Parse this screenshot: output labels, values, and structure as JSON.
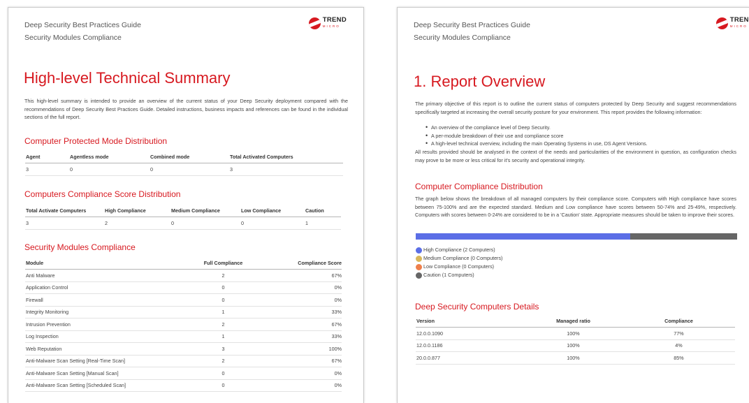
{
  "page1": {
    "header_line1": "Deep Security Best Practices Guide",
    "header_line2": "Security Modules Compliance",
    "logo_text": "TREND",
    "logo_sub": "MICRO",
    "title": "High-level Technical Summary",
    "intro": "This high-level summary is intended to provide an overview of the current status of your Deep Security deployment compared with the recommendations of Deep Security Best Practices Guide. Detailed instructions, business impacts and references can be found in the individual sections of the full report.",
    "section1": {
      "title": "Computer Protected Mode Distribution",
      "headers": [
        "Agent",
        "Agentless mode",
        "Combined mode",
        "Total Activated Computers"
      ],
      "row": [
        "3",
        "0",
        "0",
        "3"
      ]
    },
    "section2": {
      "title": "Computers Compliance Score Distribution",
      "headers": [
        "Total Activate Computers",
        "High Compliance",
        "Medium Compliance",
        "Low Compliance",
        "Caution"
      ],
      "row": [
        "3",
        "2",
        "0",
        "0",
        "1"
      ]
    },
    "section3": {
      "title": "Security Modules Compliance",
      "headers": [
        "Module",
        "Full Compliance",
        "Compliance Score"
      ],
      "rows": [
        [
          "Anti Malware",
          "2",
          "67%"
        ],
        [
          "Application Control",
          "0",
          "0%"
        ],
        [
          "Firewall",
          "0",
          "0%"
        ],
        [
          "Integrity Monitoring",
          "1",
          "33%"
        ],
        [
          "Intrusion Prevention",
          "2",
          "67%"
        ],
        [
          "Log Inspection",
          "1",
          "33%"
        ],
        [
          "Web Reputation",
          "3",
          "100%"
        ],
        [
          "Anti-Malware Scan Setting [Real-Time Scan]",
          "2",
          "67%"
        ],
        [
          "Anti-Malware Scan Setting [Manual Scan]",
          "0",
          "0%"
        ],
        [
          "Anti-Malware Scan Setting [Scheduled Scan]",
          "0",
          "0%"
        ]
      ]
    }
  },
  "page2": {
    "header_line1": "Deep Security Best Practices Guide",
    "header_line2": "Security Modules Compliance",
    "logo_text": "TREND",
    "logo_sub": "MICRO",
    "title": "1. Report Overview",
    "intro": "The primary objective of this report is to outline the current status of computers protected by Deep Security and suggest recommendations specifically targeted at increasing the overall security posture for your environment. This report provides the following information:",
    "bullets": [
      "An overview of the compliance level of Deep Security.",
      "A per-module breakdown of their use and compliance score",
      "A high-level technical overview, including the main Operating Systems in use, DS Agent Versions."
    ],
    "outro": "All results provided should be analysed in the context of the needs and particularities of the environment in question, as configuration checks may prove to be more or less critical for it's security and operational integrity.",
    "dist": {
      "title": "Computer Compliance Distribution",
      "text": "The graph below shows the breakdown of all managed computers by their compliance score. Computers with High compliance have scores between 75-100% and are the expected standard. Medium and Low compliance have scores between 50-74% and 25-49%, respectively. Computers with scores between 0-24% are considered to be in a 'Caution' state. Appropriate measures should be taken to improve their scores.",
      "segments": [
        {
          "label": "High Compliance (2 Computers)",
          "count": 2,
          "color": "#5b6ee6"
        },
        {
          "label": "Medium Compliance (0 Computers)",
          "count": 0,
          "color": "#d9b75a"
        },
        {
          "label": "Low Compliance (0 Computers)",
          "count": 0,
          "color": "#ee7f4b"
        },
        {
          "label": "Caution (1 Computers)",
          "count": 1,
          "color": "#666666"
        }
      ]
    },
    "details": {
      "title": "Deep Security Computers Details",
      "headers": [
        "Version",
        "Managed ratio",
        "Compliance"
      ],
      "rows": [
        [
          "12.0.0.1090",
          "100%",
          "77%"
        ],
        [
          "12.0.0.1186",
          "100%",
          "4%"
        ],
        [
          "20.0.0.877",
          "100%",
          "85%"
        ]
      ]
    }
  }
}
